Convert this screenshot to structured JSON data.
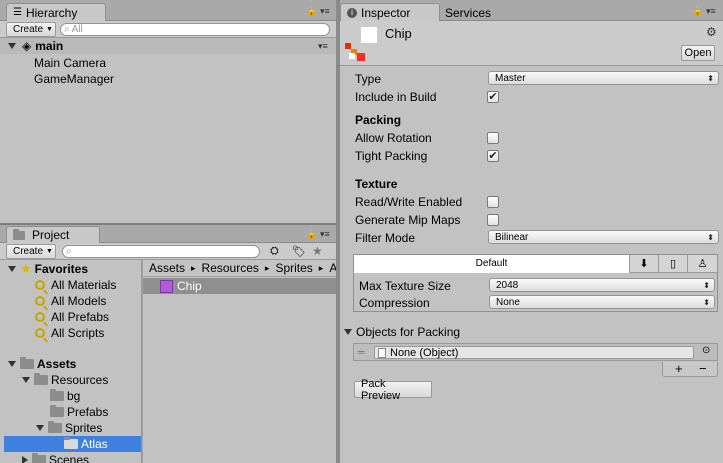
{
  "hierarchy": {
    "tab_label": "Hierarchy",
    "create_label": "Create",
    "search_placeholder": "All",
    "scene_name": "main",
    "items": [
      "Main Camera",
      "GameManager"
    ]
  },
  "project": {
    "tab_label": "Project",
    "create_label": "Create",
    "favorites_label": "Favorites",
    "favorites": [
      "All Materials",
      "All Models",
      "All Prefabs",
      "All Scripts"
    ],
    "assets_label": "Assets",
    "folders": [
      "Resources",
      "bg",
      "Prefabs",
      "Sprites",
      "Atlas",
      "Scenes"
    ],
    "breadcrumb": [
      "Assets",
      "Resources",
      "Sprites",
      "A"
    ],
    "file_name": "Chip"
  },
  "inspector": {
    "tab_label": "Inspector",
    "services_label": "Services",
    "asset_name": "Chip",
    "open_label": "Open",
    "type_label": "Type",
    "type_value": "Master",
    "include_label": "Include in Build",
    "include_checked": true,
    "packing_header": "Packing",
    "allow_rotation_label": "Allow Rotation",
    "allow_rotation_checked": false,
    "tight_packing_label": "Tight Packing",
    "tight_packing_checked": true,
    "texture_header": "Texture",
    "rw_label": "Read/Write Enabled",
    "rw_checked": false,
    "mip_label": "Generate Mip Maps",
    "mip_checked": false,
    "filter_label": "Filter Mode",
    "filter_value": "Bilinear",
    "platform_default_label": "Default",
    "max_size_label": "Max Texture Size",
    "max_size_value": "2048",
    "compression_label": "Compression",
    "compression_value": "None",
    "objects_header": "Objects for Packing",
    "object_value": "None (Object)",
    "plus_label": "+",
    "minus_label": "−",
    "pack_preview_label": "Pack Preview"
  },
  "colors": {
    "selection": "#3d80df",
    "asset_selection": "#8f8f8f",
    "panel": "#c2c2c2"
  }
}
